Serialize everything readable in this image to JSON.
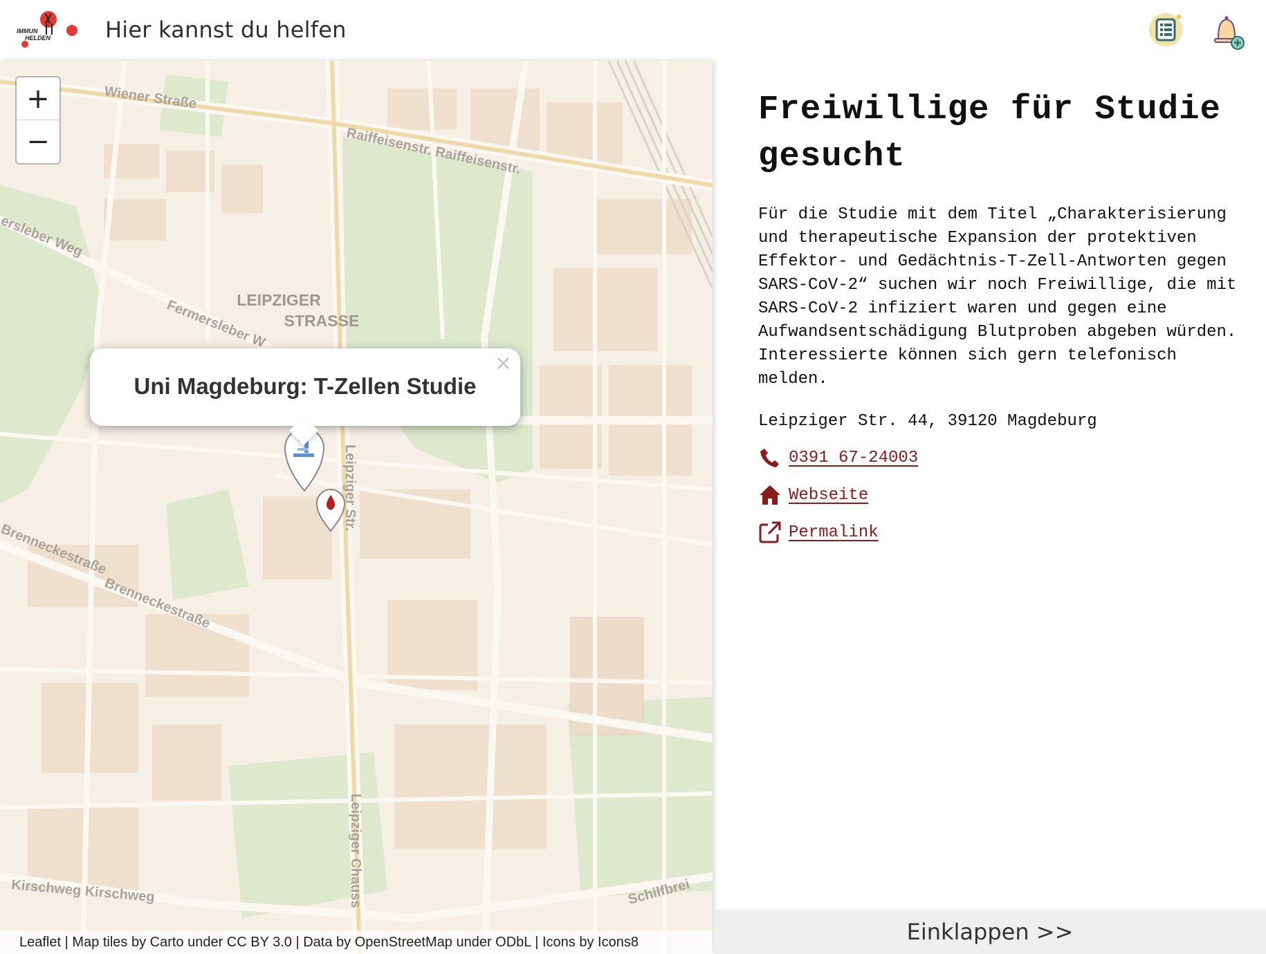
{
  "header": {
    "title": "Hier kannst du helfen",
    "logo_text_line1": "IMMUN",
    "logo_text_line2": "HELDEN",
    "list_icon": "list-icon",
    "bell_icon": "bell-add-icon"
  },
  "map": {
    "zoom_in": "+",
    "zoom_out": "−",
    "street_labels": {
      "wiener": "Wiener Straße",
      "raiffeisen": "Raiffeisenstr. Raiffeisenstr.",
      "fermersleben1": "ersleber Weg",
      "fermersleben2": "Fermersleber W",
      "district1": "LEIPZIGER",
      "district2": "STRASSE",
      "leipziger_str": "Leipziger Str.",
      "brennecke1": "Brenneckestraße",
      "brennecke2": "Brenneckestraße",
      "leipziger_chaus": "Leipziger Chauss",
      "kirschweg": "Kirschweg Kirschweg",
      "schilfbreite": "Schilfbrei"
    },
    "popup_title": "Uni Magdeburg: T-Zellen Studie",
    "popup_close": "×",
    "markers": [
      "microscope-marker-icon",
      "blood-drop-marker-icon"
    ],
    "attribution": "Leaflet | Map tiles by Carto under CC BY 3.0 | Data by OpenStreetMap under ODbL | Icons by Icons8"
  },
  "detail": {
    "title": "Freiwillige für Studie gesucht",
    "description": "Für die Studie mit dem Titel „Charakterisierung und therapeutische Expansion der protektiven Effektor- und Gedächtnis-T-Zell-Antworten gegen SARS-CoV-2“ suchen wir noch Freiwillige, die mit SARS-CoV-2 infiziert waren und gegen eine Aufwandsentschädigung Blutproben abgeben würden. Interessierte können sich gern telefonisch melden.",
    "address": "Leipziger Str. 44, 39120 Magdeburg",
    "phone": "0391 67-24003",
    "website": "Webseite",
    "permalink": "Permalink"
  },
  "collapse_label": "Einklappen >>",
  "colors": {
    "accent": "#8b1a1a",
    "logo_red": "#e53935",
    "map_bg": "#f6efe5",
    "park": "#dde8cd"
  }
}
